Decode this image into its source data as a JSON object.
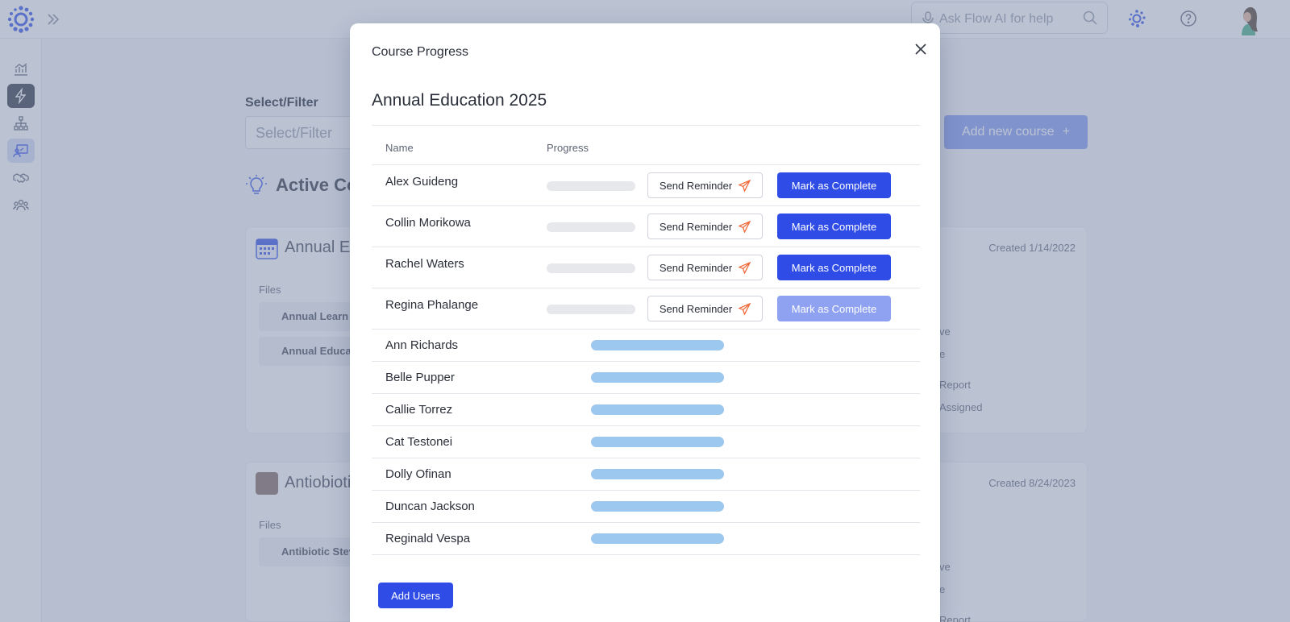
{
  "topbar": {
    "ai_search_placeholder": "Ask Flow AI for help"
  },
  "main": {
    "filter_label": "Select/Filter",
    "filter_placeholder": "Select/Filter",
    "add_course_label": "Add new course",
    "active_heading": "Active Co",
    "courses": [
      {
        "title": "Annual Ed",
        "created": "Created 1/14/2022",
        "files_label": "Files",
        "files": [
          "Annual Learn",
          "Annual Educa"
        ],
        "meta": [
          "ve",
          "e",
          "Report",
          "Assigned"
        ]
      },
      {
        "title": "Antiobioti",
        "created": "Created 8/24/2023",
        "files_label": "Files",
        "files": [
          "Antibiotic Stev"
        ],
        "meta": [
          "ve",
          "e",
          "Report"
        ]
      }
    ]
  },
  "modal": {
    "title": "Course Progress",
    "course_name": "Annual Education 2025",
    "columns": {
      "name": "Name",
      "progress": "Progress"
    },
    "send_reminder_label": "Send Reminder",
    "mark_complete_label": "Mark as Complete",
    "pending_users": [
      {
        "name": "Alex Guideng",
        "progress": 0,
        "complete_enabled": true
      },
      {
        "name": "Collin Morikowa",
        "progress": 0,
        "complete_enabled": true
      },
      {
        "name": "Rachel Waters",
        "progress": 0,
        "complete_enabled": true
      },
      {
        "name": "Regina Phalange",
        "progress": 0,
        "complete_enabled": false
      }
    ],
    "completed_users": [
      {
        "name": "Ann Richards",
        "progress": 1
      },
      {
        "name": "Belle Pupper",
        "progress": 1
      },
      {
        "name": "Callie Torrez",
        "progress": 1
      },
      {
        "name": "Cat Testonei",
        "progress": 1
      },
      {
        "name": "Dolly Ofinan",
        "progress": 1
      },
      {
        "name": "Duncan Jackson",
        "progress": 1
      },
      {
        "name": "Reginald Vespa",
        "progress": 1
      }
    ],
    "add_users_label": "Add Users"
  },
  "colors": {
    "primary": "#2f4de6",
    "primary_disabled": "#8ea2f1",
    "complete_bar": "#9cc8ef",
    "reminder_icon": "#f06a3a"
  }
}
